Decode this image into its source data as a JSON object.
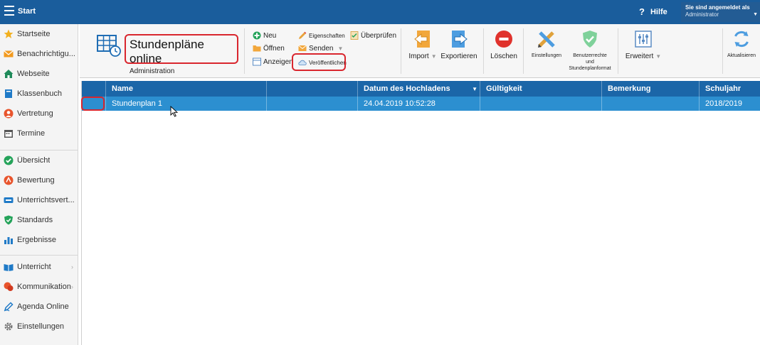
{
  "topbar": {
    "title": "Start",
    "help_icon": "?",
    "help_label": "Hilfe",
    "login_line1": "Sie sind angemeldet als",
    "login_user": "Administrator"
  },
  "sidebar": {
    "items": [
      {
        "label": "Startseite",
        "icon": "star-icon"
      },
      {
        "label": "Benachrichtigu...",
        "icon": "envelope-icon"
      },
      {
        "label": "Webseite",
        "icon": "house-icon"
      },
      {
        "label": "Klassenbuch",
        "icon": "book-icon"
      },
      {
        "label": "Vertretung",
        "icon": "person-icon"
      },
      {
        "label": "Termine",
        "icon": "calendar-icon"
      },
      {
        "label": "Übersicht",
        "icon": "check-icon"
      },
      {
        "label": "Bewertung",
        "icon": "rating-icon"
      },
      {
        "label": "Unterrichtsvert...",
        "icon": "distribution-icon"
      },
      {
        "label": "Standards",
        "icon": "shield-icon"
      },
      {
        "label": "Ergebnisse",
        "icon": "bar-chart-icon"
      },
      {
        "label": "Unterricht",
        "icon": "lesson-icon"
      },
      {
        "label": "Kommunikation",
        "icon": "chat-icon"
      },
      {
        "label": "Agenda Online",
        "icon": "pen-icon"
      },
      {
        "label": "Einstellungen",
        "icon": "gear-icon"
      }
    ]
  },
  "ribbon": {
    "module_title": "Stundenpläne online",
    "module_subtitle": "Administration",
    "neu": "Neu",
    "oeffnen": "Öffnen",
    "anzeigen": "Anzeigen",
    "eigenschaften": "Eigenschaften",
    "senden": "Senden",
    "veroeffentlichen": "Veröffentlichen",
    "ueberpruefen": "Überprüfen",
    "import": "Import",
    "exportieren": "Exportieren",
    "loeschen": "Löschen",
    "einstellungen": "Einstellungen",
    "benutzerrechte_1": "Benutzerrechte",
    "benutzerrechte_2": "und",
    "benutzerrechte_3": "Stundenplanformat",
    "erweitert": "Erweitert",
    "aktualisieren": "Aktualisieren"
  },
  "grid": {
    "columns": [
      "Name",
      "",
      "Datum des Hochladens",
      "Gültigkeit",
      "Bemerkung",
      "Schuljahr"
    ],
    "rows": [
      [
        "Stundenplan 1",
        "",
        "24.04.2019 10:52:28",
        "",
        "",
        "2018/2019"
      ]
    ]
  },
  "colors": {
    "topbar": "#1a5d9c",
    "grid_header": "#1b66a8",
    "selected_row": "#2c8fd0",
    "highlight": "#d9262e"
  }
}
